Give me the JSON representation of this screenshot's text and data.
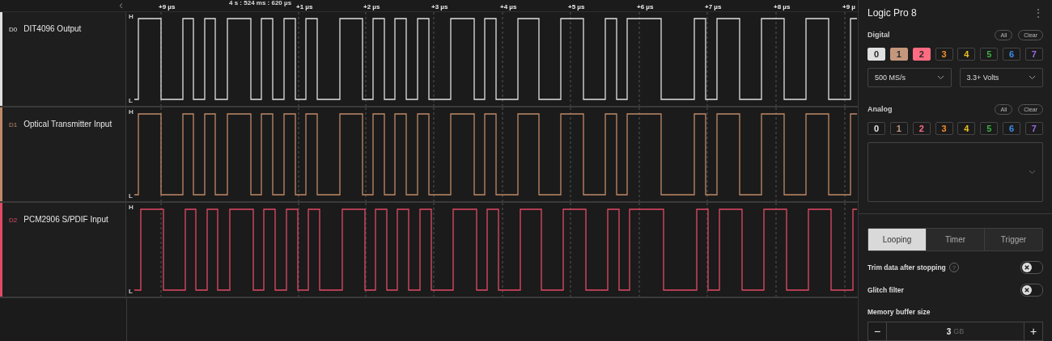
{
  "timeline": {
    "timestamp": "4 s : 524 ms : 620 µs",
    "collapse_icon": "‹",
    "ticks": [
      "+9 µs",
      "+1 µs",
      "+2 µs",
      "+3 µs",
      "+4 µs",
      "+5 µs",
      "+6 µs",
      "+7 µs",
      "+8 µs",
      "+9 µ"
    ]
  },
  "channels": [
    {
      "id": "D0",
      "name": "DIT4096 Output",
      "color": "#e0e0e0",
      "high_label": "H",
      "low_label": "L"
    },
    {
      "id": "D1",
      "name": "Optical Transmitter Input",
      "color": "#c08a68",
      "high_label": "H",
      "low_label": "L"
    },
    {
      "id": "D2",
      "name": "PCM2906 S/PDIF Input",
      "color": "#e24a66",
      "high_label": "H",
      "low_label": "L"
    }
  ],
  "sidebar": {
    "title": "Logic Pro 8",
    "menu_icon": "⋮",
    "digital": {
      "label": "Digital",
      "all_button": "All",
      "clear_button": "Clear",
      "channels": [
        {
          "label": "0",
          "selected": true,
          "color": "#e0e0e0"
        },
        {
          "label": "1",
          "selected": true,
          "color": "#c4977c"
        },
        {
          "label": "2",
          "selected": true,
          "color": "#ff6b81"
        },
        {
          "label": "3",
          "selected": false,
          "color": "#f0902a"
        },
        {
          "label": "4",
          "selected": false,
          "color": "#e8c020"
        },
        {
          "label": "5",
          "selected": false,
          "color": "#3cb043"
        },
        {
          "label": "6",
          "selected": false,
          "color": "#3a8ee8"
        },
        {
          "label": "7",
          "selected": false,
          "color": "#9a6ae8"
        }
      ],
      "sample_rate": "500 MS/s",
      "voltage": "3.3+ Volts"
    },
    "analog": {
      "label": "Analog",
      "all_button": "All",
      "clear_button": "Clear",
      "channels": [
        {
          "label": "0",
          "selected": false,
          "color": "#e0e0e0"
        },
        {
          "label": "1",
          "selected": false,
          "color": "#c4977c"
        },
        {
          "label": "2",
          "selected": false,
          "color": "#ff6b81"
        },
        {
          "label": "3",
          "selected": false,
          "color": "#f0902a"
        },
        {
          "label": "4",
          "selected": false,
          "color": "#e8c020"
        },
        {
          "label": "5",
          "selected": false,
          "color": "#3cb043"
        },
        {
          "label": "6",
          "selected": false,
          "color": "#3a8ee8"
        },
        {
          "label": "7",
          "selected": false,
          "color": "#9a6ae8"
        }
      ]
    },
    "modes": [
      {
        "label": "Looping",
        "selected": true
      },
      {
        "label": "Timer",
        "selected": false
      },
      {
        "label": "Trigger",
        "selected": false
      }
    ],
    "settings": [
      {
        "label": "Trim data after stopping",
        "help": "?",
        "on": false
      },
      {
        "label": "Glitch filter",
        "on": false
      }
    ],
    "memory": {
      "label": "Memory buffer size",
      "minus": "−",
      "value": "3",
      "unit": "GB",
      "plus": "+"
    }
  }
}
